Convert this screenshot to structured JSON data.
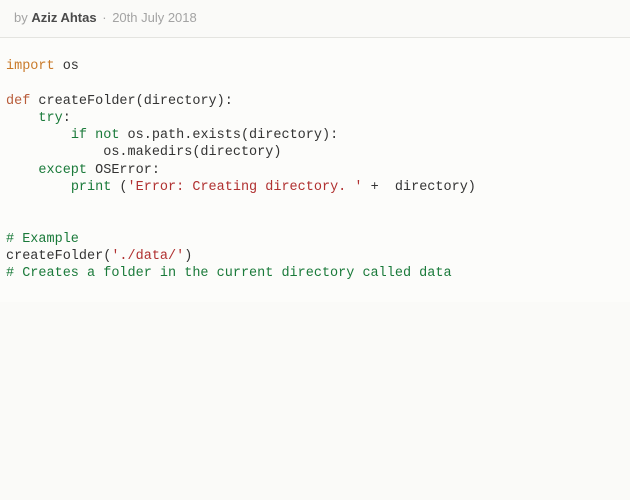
{
  "byline": {
    "prefix": "by ",
    "author": "Aziz Ahtas",
    "dot": "·",
    "date": "20th July 2018"
  },
  "code": {
    "tokens": [
      {
        "t": "import",
        "c": "kw-import"
      },
      {
        "t": " os\n\n",
        "c": "plain"
      },
      {
        "t": "def",
        "c": "kw-def"
      },
      {
        "t": " createFolder(directory):\n",
        "c": "plain"
      },
      {
        "t": "    ",
        "c": "plain"
      },
      {
        "t": "try",
        "c": "kw-flow"
      },
      {
        "t": ":\n",
        "c": "plain"
      },
      {
        "t": "        ",
        "c": "plain"
      },
      {
        "t": "if",
        "c": "kw-flow"
      },
      {
        "t": " ",
        "c": "plain"
      },
      {
        "t": "not",
        "c": "kw-flow"
      },
      {
        "t": " os.path.exists(directory):\n",
        "c": "plain"
      },
      {
        "t": "            os.makedirs(directory)\n",
        "c": "plain"
      },
      {
        "t": "    ",
        "c": "plain"
      },
      {
        "t": "except",
        "c": "kw-flow"
      },
      {
        "t": " OSError:\n",
        "c": "plain"
      },
      {
        "t": "        ",
        "c": "plain"
      },
      {
        "t": "print",
        "c": "kw-builtin"
      },
      {
        "t": " (",
        "c": "plain"
      },
      {
        "t": "'Error: Creating directory. '",
        "c": "str"
      },
      {
        "t": " +  directory)\n",
        "c": "plain"
      },
      {
        "t": "\n\n",
        "c": "plain"
      },
      {
        "t": "# Example\n",
        "c": "comment"
      },
      {
        "t": "createFolder(",
        "c": "plain"
      },
      {
        "t": "'./data/'",
        "c": "str"
      },
      {
        "t": ")\n",
        "c": "plain"
      },
      {
        "t": "# Creates a folder in the current directory called data",
        "c": "comment"
      }
    ]
  }
}
